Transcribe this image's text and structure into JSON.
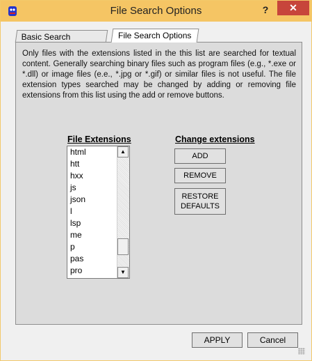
{
  "window": {
    "title": "File Search Options",
    "help_label": "?",
    "close_label": "✕"
  },
  "tabs": [
    {
      "label": "Basic Search Options",
      "active": false
    },
    {
      "label": "File Search Options",
      "active": true
    }
  ],
  "description": "Only files with the extensions listed in the this list are searched for textual content. Generally searching binary files such as program files (e.g., *.exe or *.dll) or image files (e.e., *.jpg or *.gif) or similar files is not useful. The file extension types searched may be changed by adding or removing file extensions from this list using the add or remove buttons.",
  "extensions": {
    "label": "File Extensions",
    "items": [
      "html",
      "htt",
      "hxx",
      "js",
      "json",
      "l",
      "lsp",
      "me",
      "p",
      "pas",
      "pro"
    ]
  },
  "change": {
    "label": "Change extensions",
    "add_label": "ADD",
    "remove_label": "REMOVE",
    "restore_label_line1": "RESTORE",
    "restore_label_line2": "DEFAULTS"
  },
  "footer": {
    "apply_label": "APPLY",
    "cancel_label": "Cancel"
  },
  "colors": {
    "titlebar": "#f5c564",
    "close": "#c7453b",
    "panel": "#dcdcdc"
  }
}
